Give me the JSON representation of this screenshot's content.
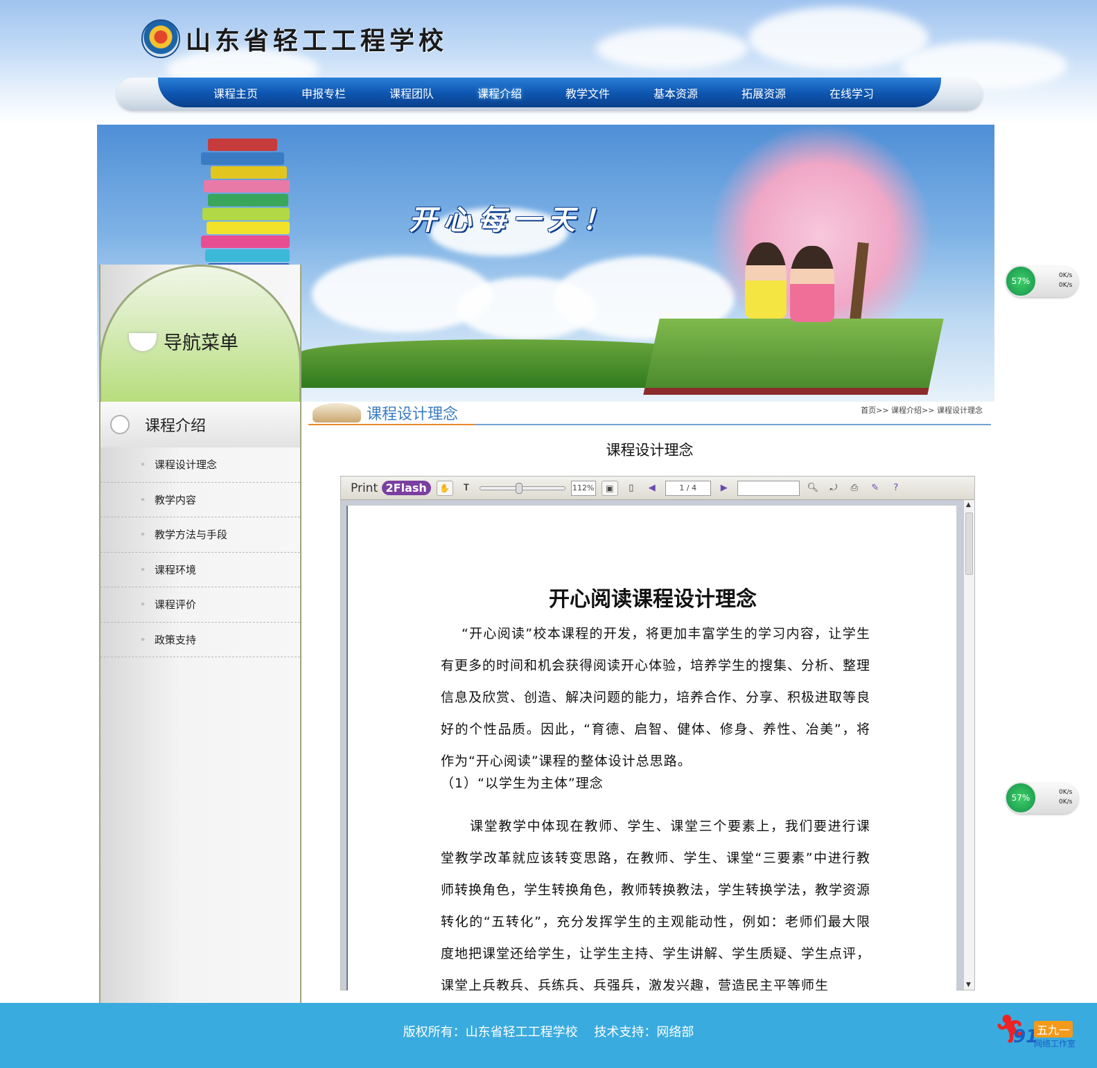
{
  "site": {
    "school_name": "山东省轻工工程学校"
  },
  "nav": {
    "items": [
      "课程主页",
      "申报专栏",
      "课程团队",
      "课程介绍",
      "教学文件",
      "基本资源",
      "拓展资源",
      "在线学习"
    ],
    "active_index": 3
  },
  "banner": {
    "slogan": "开心每一天！"
  },
  "sidebar": {
    "nav_title": "导航菜单",
    "section_title": "课程介绍",
    "items": [
      "课程设计理念",
      "教学内容",
      "教学方法与手段",
      "课程环境",
      "课程评价",
      "政策支持"
    ]
  },
  "content": {
    "title": "课程设计理念",
    "breadcrumb": "首页>> 课程介绍>> 课程设计理念",
    "doc_title": "课程设计理念"
  },
  "viewer": {
    "brand_text": "Print",
    "brand_pill": "2Flash",
    "zoom": "112%",
    "page_indicator": "1 / 4",
    "search_value": "",
    "zoom_level_fraction": 0.45,
    "icons": [
      "hand-icon",
      "text-select-icon",
      "fit-page-icon",
      "single-page-icon",
      "prev-page-icon",
      "next-page-icon",
      "search-icon",
      "rotate-icon",
      "print-icon",
      "edit-icon",
      "help-icon"
    ]
  },
  "document": {
    "heading": "开心阅读课程设计理念",
    "paragraph1": "“开心阅读”校本课程的开发，将更加丰富学生的学习内容，让学生有更多的时间和机会获得阅读开心体验，培养学生的搜集、分析、整理信息及欣赏、创造、解决问题的能力，培养合作、分享、积极进取等良好的个性品质。因此，“育德、启智、健体、修身、养性、冶美”，将作为“开心阅读”课程的整体设计总思路。",
    "item1": "（1）“以学生为主体”理念",
    "paragraph2": "课堂教学中体现在教师、学生、课堂三个要素上，我们要进行课堂教学改革就应该转变思路，在教师、学生、课堂“三要素”中进行教师转换角色，学生转换角色，教师转换教法，学生转换学法，教学资源转化的“五转化”，充分发挥学生的主观能动性，例如：老师们最大限度地把课堂还给学生，让学生主持、学生讲解、学生质疑、学生点评，课堂上兵教兵、兵练兵、兵强兵，激发兴趣，营造民主平等师生"
  },
  "speed_widgets": [
    {
      "percent": "57%",
      "up": "0K/s",
      "down": "0K/s"
    },
    {
      "percent": "57%",
      "up": "0K/s",
      "down": "0K/s"
    }
  ],
  "footer": {
    "text": "版权所有：山东省轻工工程学校　 技术支持：网络部"
  },
  "badge": {
    "number": "91",
    "cn": "五九一",
    "sub": "网络工作室"
  },
  "colors": {
    "nav_blue": "#0f58b3",
    "footer_blue": "#3aabde",
    "title_blue": "#3a7cc4",
    "speed_green": "#16914a"
  }
}
